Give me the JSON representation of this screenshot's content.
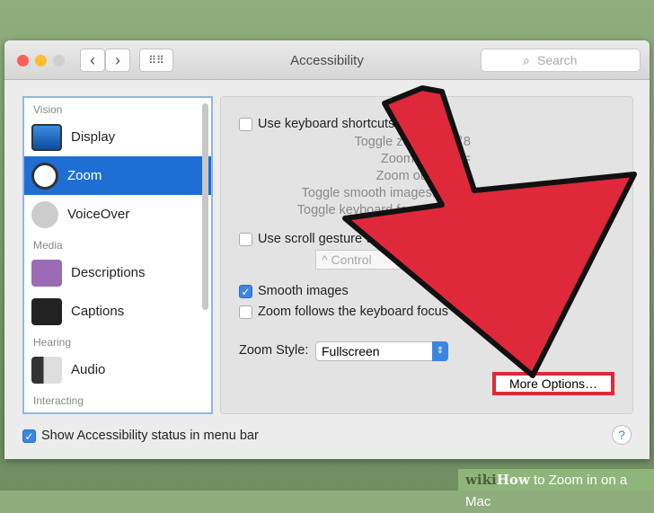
{
  "window": {
    "title": "Accessibility",
    "search_placeholder": "Search",
    "nav_back": "‹",
    "nav_forward": "›"
  },
  "sidebar": {
    "sections": [
      "Vision",
      "Media",
      "Hearing",
      "Interacting"
    ],
    "items": [
      {
        "label": "Display",
        "icon": "display-icon"
      },
      {
        "label": "Zoom",
        "icon": "zoom-icon",
        "selected": true
      },
      {
        "label": "VoiceOver",
        "icon": "voiceover-icon"
      },
      {
        "label": "Descriptions",
        "icon": "descriptions-icon"
      },
      {
        "label": "Captions",
        "icon": "captions-icon"
      },
      {
        "label": "Audio",
        "icon": "audio-icon"
      }
    ]
  },
  "panel": {
    "keyboard_shortcuts": {
      "label": "Use keyboard shortcuts to zoom",
      "checked": false
    },
    "shortcuts": [
      "Toggle zoom: ⌥⌘8",
      "Zoom in: ⌥⌘=",
      "Zoom out: ⌥⌘-",
      "Toggle smooth images: ⌥⌘\\",
      "Toggle keyboard focus: ⌥⌘F"
    ],
    "scroll_gesture": {
      "label": "Use scroll gesture with modifier keys to zoom",
      "checked": false,
      "modifier": "^ Control"
    },
    "smooth_images": {
      "label": "Smooth images",
      "checked": true
    },
    "follow_focus": {
      "label": "Zoom follows the keyboard focus",
      "checked": false
    },
    "zoom_style": {
      "label": "Zoom Style:",
      "value": "Fullscreen"
    },
    "more_options": "More Options…"
  },
  "footer": {
    "status_label": "Show Accessibility status in menu bar",
    "checked": true,
    "help": "?"
  },
  "watermark": {
    "wiki": "wiki",
    "how": "How",
    "rest": " to Zoom in on a Mac"
  },
  "colors": {
    "accent": "#1f6ed4",
    "arrow": "#e0283b",
    "highlight": "#e0283b"
  }
}
